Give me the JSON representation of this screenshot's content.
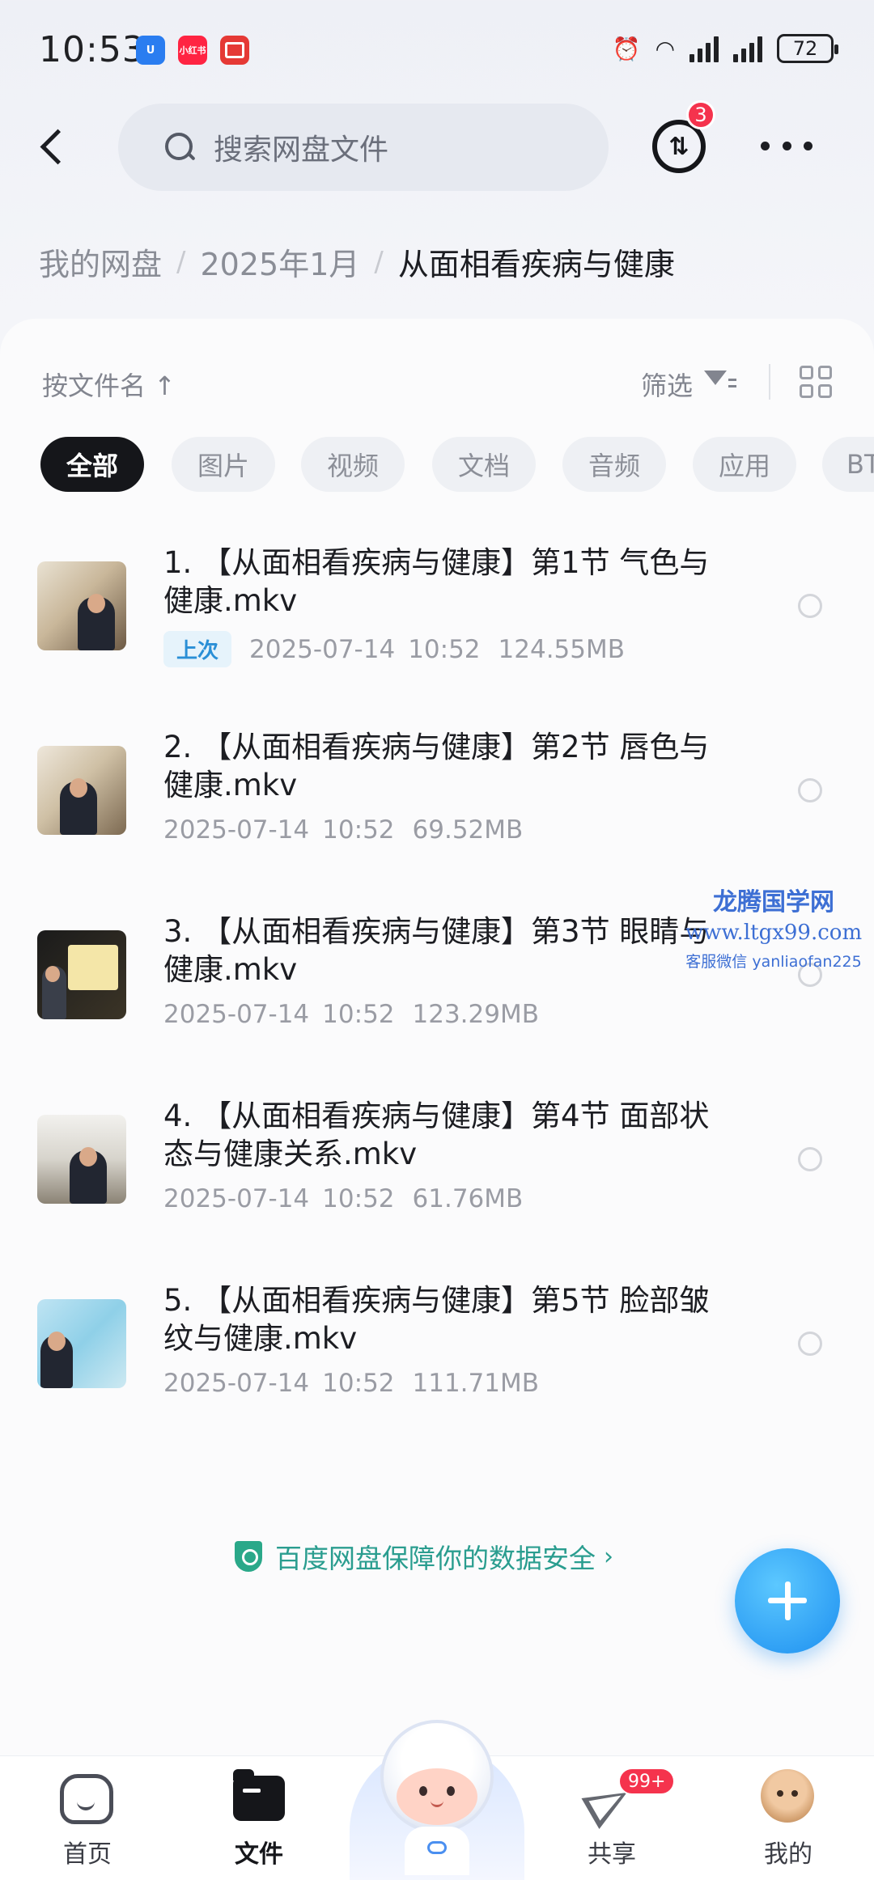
{
  "status_bar": {
    "time": "10:53",
    "apps": [
      "U",
      "小红书",
      ""
    ],
    "battery": "72"
  },
  "header": {
    "search_placeholder": "搜索网盘文件",
    "transfer_badge": "3"
  },
  "breadcrumb": [
    "我的网盘",
    "2025年1月",
    "从面相看疾病与健康"
  ],
  "toolbar": {
    "sort_label": "按文件名 ↑",
    "filter_label": "筛选"
  },
  "chips": [
    "全部",
    "图片",
    "视频",
    "文档",
    "音频",
    "应用",
    "BT"
  ],
  "files": [
    {
      "name": "1. 【从面相看疾病与健康】第1节 气色与健康.mkv",
      "tag": "上次",
      "date": "2025-07-14",
      "time": "10:52",
      "size": "124.55MB"
    },
    {
      "name": "2. 【从面相看疾病与健康】第2节 唇色与健康.mkv",
      "tag": "",
      "date": "2025-07-14",
      "time": "10:52",
      "size": "69.52MB"
    },
    {
      "name": "3. 【从面相看疾病与健康】第3节 眼睛与健康.mkv",
      "tag": "",
      "date": "2025-07-14",
      "time": "10:52",
      "size": "123.29MB"
    },
    {
      "name": "4. 【从面相看疾病与健康】第4节 面部状态与健康关系.mkv",
      "tag": "",
      "date": "2025-07-14",
      "time": "10:52",
      "size": "61.76MB"
    },
    {
      "name": "5. 【从面相看疾病与健康】第5节 脸部皱纹与健康.mkv",
      "tag": "",
      "date": "2025-07-14",
      "time": "10:52",
      "size": "111.71MB"
    }
  ],
  "watermark": {
    "title": "龙腾国学网",
    "url": "www.ltgx99.com",
    "contact": "客服微信 yanliaofan225"
  },
  "security_banner": "百度网盘保障你的数据安全",
  "bottom_nav": {
    "home": "首页",
    "files": "文件",
    "share": "共享",
    "share_badge": "99+",
    "mine": "我的"
  }
}
